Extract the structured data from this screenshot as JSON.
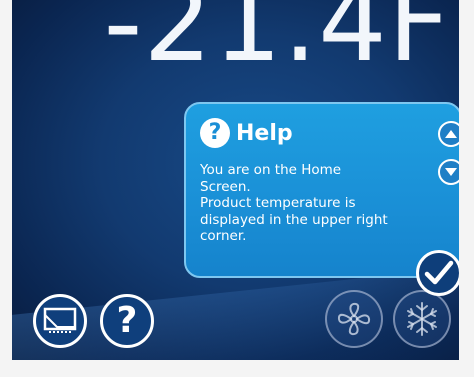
{
  "display": {
    "temperature": "-21.4F"
  },
  "help": {
    "title": "Help",
    "lines": [
      "You are on the Home",
      "Screen.",
      "Product temperature is",
      "displayed in the upper right",
      "corner."
    ]
  },
  "icons": {
    "help_panel": "question-icon",
    "scroll_up": "chevron-up-icon",
    "scroll_down": "chevron-down-icon",
    "confirm": "checkmark-icon",
    "screen": "display-screen-icon",
    "help": "question-icon",
    "fan": "fan-icon",
    "snow": "snowflake-icon"
  },
  "colors": {
    "background": "#123a70",
    "panel": "#1a8fd6",
    "text": "#ffffff"
  }
}
